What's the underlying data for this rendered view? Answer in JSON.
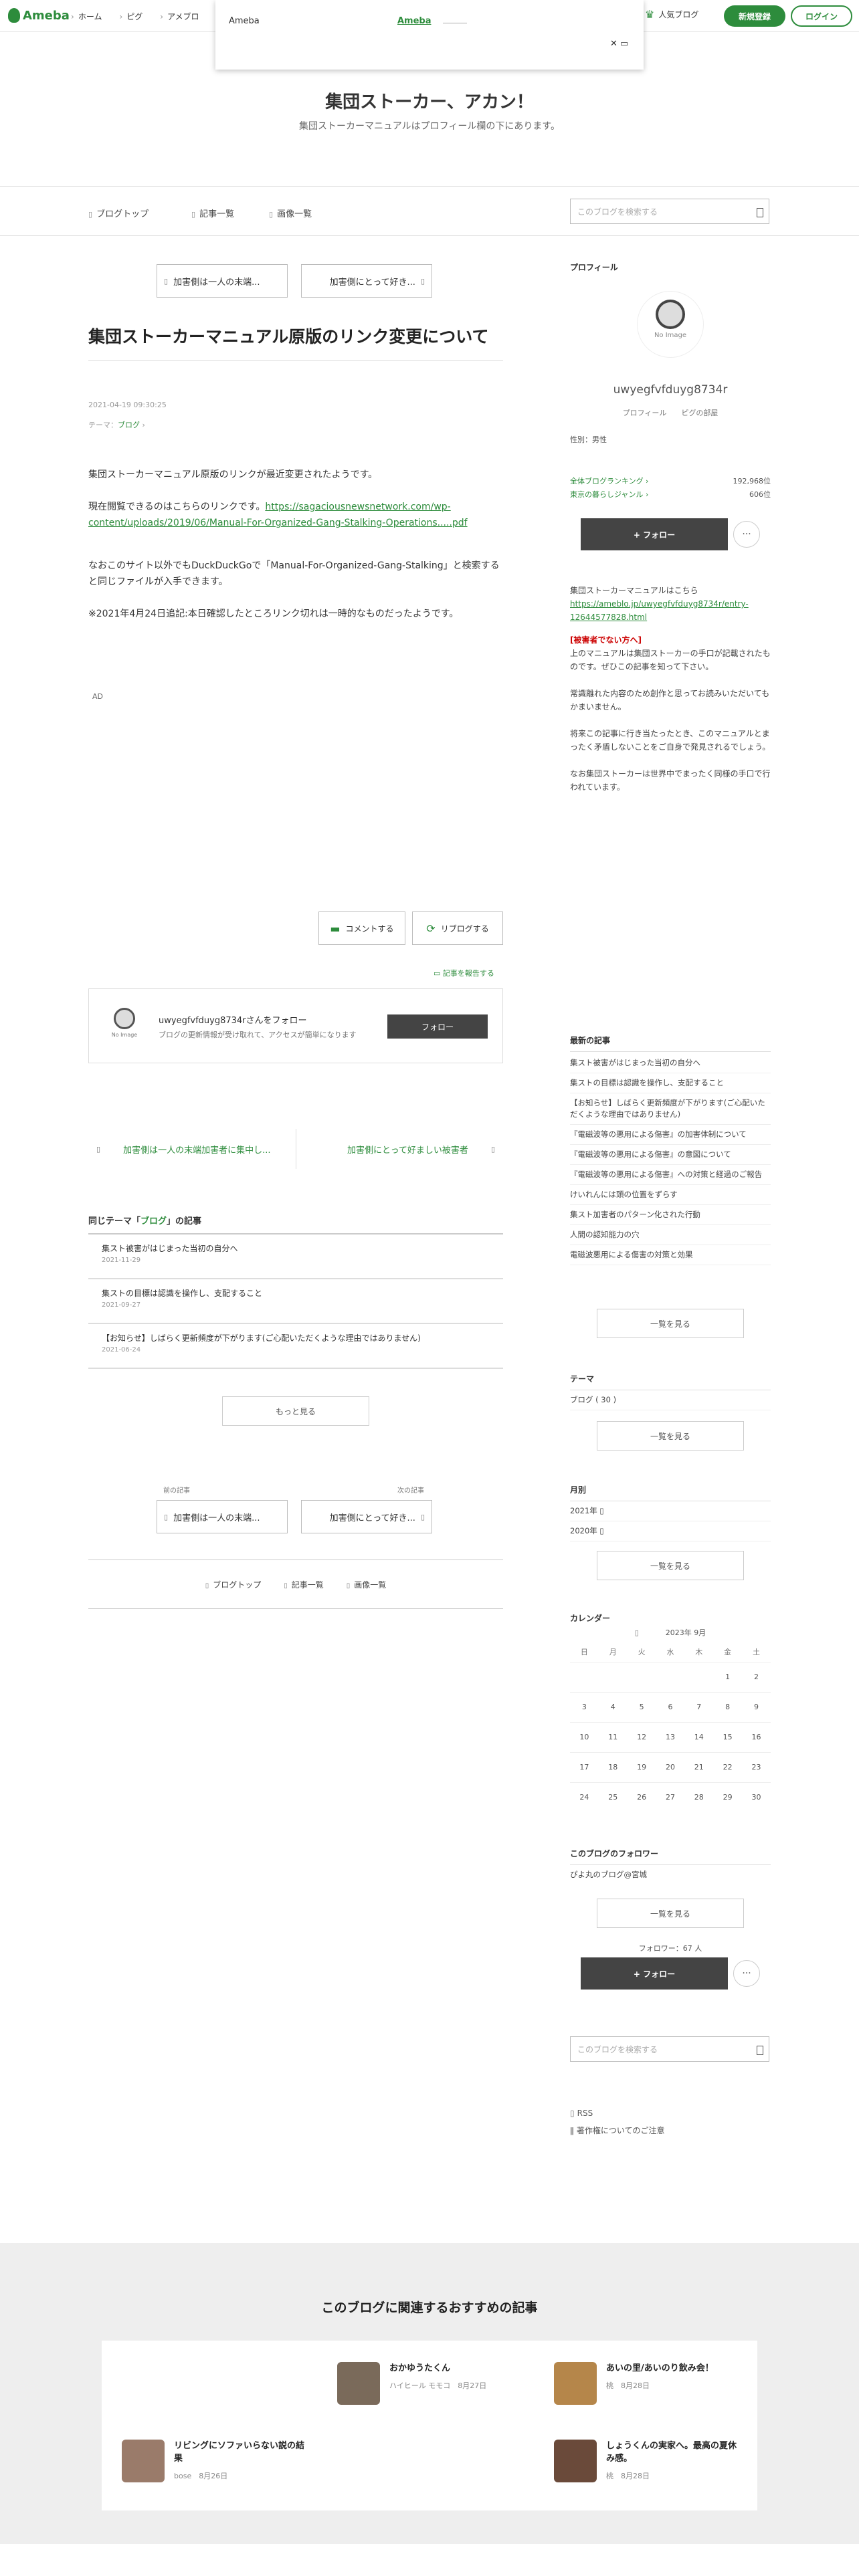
{
  "header": {
    "logo": "Ameba",
    "nav": [
      "ホーム",
      "ピグ",
      "アメブロ"
    ],
    "popup_title": "Ameba",
    "popup_link": "Ameba",
    "popup_close": "✕ ▭",
    "ranking": "人気ブログ",
    "register": "新規登録",
    "login": "ログイン"
  },
  "blog": {
    "title": "集団ストーカー、アカン！",
    "description": "集団ストーカーマニュアルはプロフィール欄の下にあります。",
    "nav": [
      "ブログトップ",
      "記事一覧",
      "画像一覧"
    ],
    "search_placeholder": "このブログを検索する"
  },
  "article": {
    "prev": "加害側は一人の末端...",
    "next": "加害側にとって好き...",
    "title": "集団ストーカーマニュアル原版のリンク変更について",
    "date": "2021-04-19 09:30:25",
    "theme_label": "テーマ：",
    "theme": "ブログ",
    "p1": "集団ストーカーマニュアル原版のリンクが最近変更されたようです。",
    "p2": "現在閲覧できるのはこちらのリンクです。",
    "link": "https://sagaciousnewsnetwork.com/wp-content/uploads/2019/06/Manual-For-Organized-Gang-Stalking-Operations.....pdf",
    "p3": "なおこのサイト以外でもDuckDuckGoで「Manual-For-Organized-Gang-Stalking」と検索すると同じファイルが入手できます。",
    "p4": "※2021年4月24日追記:本日確認したところリンク切れは一時的なものだったようです。",
    "ad": "AD",
    "comment": "コメントする",
    "reblog": "リブログする",
    "report": "記事を報告する"
  },
  "follow_box": {
    "noimage": "No Image",
    "name": "uwyegfvfduyg8734rさんをフォロー",
    "desc": "ブログの更新情報が受け取れて、アクセスが簡単になります",
    "button": "フォロー"
  },
  "adjacent": {
    "prev": "加害側は一人の末端加害者に集中し...",
    "next": "加害側にとって好ましい被害者"
  },
  "same_theme": {
    "pre": "同じテーマ「",
    "theme": "ブログ",
    "post": "」の記事",
    "items": [
      {
        "title": "集スト被害がはじまった当初の自分へ",
        "date": "2021-11-29"
      },
      {
        "title": "集ストの目標は認識を操作し、支配すること",
        "date": "2021-09-27"
      },
      {
        "title": "【お知らせ】しばらく更新頻度が下がります(ご心配いただくような理由ではありません)",
        "date": "2021-06-24"
      }
    ],
    "more": "もっと見る"
  },
  "bottom_pager": {
    "prev_label": "前の記事",
    "next_label": "次の記事",
    "prev": "加害側は一人の末端...",
    "next": "加害側にとって好き..."
  },
  "sidebar": {
    "profile_heading": "プロフィール",
    "noimage": "No Image",
    "username": "uwyegfvfduyg8734r",
    "profile_links": "プロフィール　　ピグの部屋",
    "sex": "性別：男性",
    "rank1_label": "全体ブログランキング",
    "rank1_value": "192,968位",
    "rank2_label": "東京の暮らしジャンル",
    "rank2_value": "606位",
    "follow": "+ フォロー",
    "dots": "···",
    "manual_intro": "集団ストーカーマニュアルはこちら",
    "manual_link": "https://ameblo.jp/uwyegfvfduyg8734r/entry-12644577828.html",
    "red": "[被害者でない方へ]",
    "text1": "上のマニュアルは集団ストーカーの手口が記載されたものです。ぜひこの記事を知って下さい。",
    "text2": "常識離れた内容のため創作と思ってお読みいただいてもかまいません。",
    "text3": "将来この記事に行き当たったとき、このマニュアルとまったく矛盾しないことをご自身で発見されるでしょう。",
    "text4": "なお集団ストーカーは世界中でまったく同様の手口で行われています。",
    "recent_heading": "最新の記事",
    "recent": [
      "集スト被害がはじまった当初の自分へ",
      "集ストの目標は認識を操作し、支配すること",
      "【お知らせ】しばらく更新頻度が下がります(ご心配いただくような理由ではありません)",
      "『電磁波等の悪用による傷害』の加害体制について",
      "『電磁波等の悪用による傷害』の意図について",
      "『電磁波等の悪用による傷害』への対策と経過のご報告",
      "けいれんには頭の位置をずらす",
      "集スト加害者のパターン化された行動",
      "人間の認知能力の穴",
      "電磁波悪用による傷害の対策と効果"
    ],
    "list_all": "一覧を見る",
    "theme_heading": "テーマ",
    "theme_item": "ブログ ( 30 )",
    "monthly_heading": "月別",
    "months": [
      "2021年",
      "2020年"
    ],
    "calendar_heading": "カレンダー",
    "calendar_month": "2023年 9月",
    "weekdays": [
      "日",
      "月",
      "火",
      "水",
      "木",
      "金",
      "土"
    ],
    "weeks": [
      [
        "",
        "",
        "",
        "",
        "",
        "1",
        "2"
      ],
      [
        "3",
        "4",
        "5",
        "6",
        "7",
        "8",
        "9"
      ],
      [
        "10",
        "11",
        "12",
        "13",
        "14",
        "15",
        "16"
      ],
      [
        "17",
        "18",
        "19",
        "20",
        "21",
        "22",
        "23"
      ],
      [
        "24",
        "25",
        "26",
        "27",
        "28",
        "29",
        "30"
      ]
    ],
    "followers_heading": "このブログのフォロワー",
    "follower_item": "ぴよ丸のブログ@宮城",
    "follower_count": "フォロワー：67 人",
    "rss": "RSS",
    "copyright": "著作権についてのご注意"
  },
  "recommend": {
    "heading": "このブログに関連するおすすめの記事",
    "items": [
      {
        "title": "おかゆうたくん",
        "meta": "ハイヒール モモコ　8月27日",
        "color": "#7a6a5a"
      },
      {
        "title": "あいの里/あいのり飲み会！",
        "meta": "桃　8月28日",
        "color": "#b5864a"
      },
      {
        "title": "リビングにソファいらない説の結果",
        "meta": "bose　8月26日",
        "color": "#9a7b6a"
      },
      {
        "title": "しょうくんの実家へ。最高の夏休み感。",
        "meta": "桃　8月28日",
        "color": "#6a4a3a"
      }
    ]
  }
}
